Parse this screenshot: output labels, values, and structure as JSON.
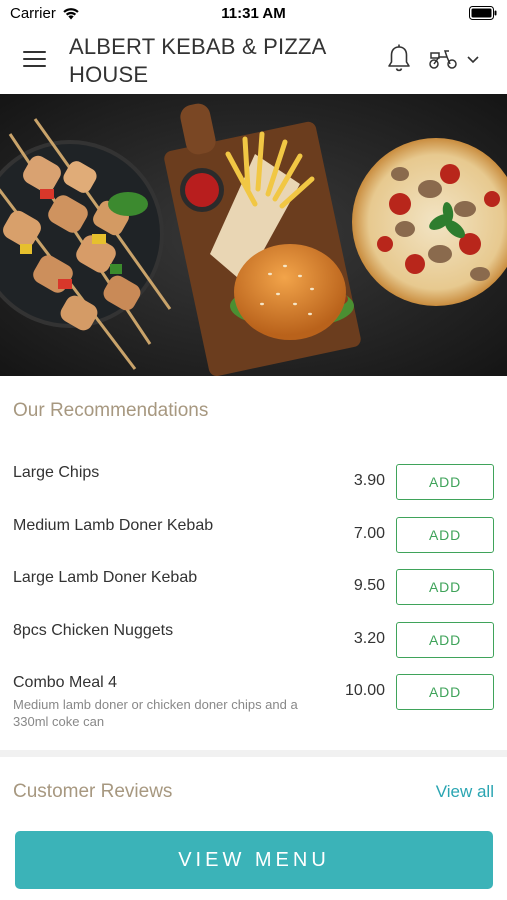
{
  "status_bar": {
    "carrier": "Carrier",
    "time": "11:31 AM"
  },
  "header": {
    "title": "ALBERT KEBAB & PIZZA HOUSE",
    "menu_icon": "hamburger-menu-icon",
    "bell_icon": "bell-icon",
    "delivery_icon": "scooter-icon",
    "dropdown_icon": "chevron-down-icon"
  },
  "hero": {
    "image": "food-banner-kebab-burger-pizza"
  },
  "recommendations": {
    "title": "Our Recommendations",
    "add_label": "ADD",
    "items": [
      {
        "name": "Large Chips",
        "price": "3.90",
        "description": ""
      },
      {
        "name": "Medium Lamb Doner Kebab",
        "price": "7.00",
        "description": ""
      },
      {
        "name": "Large Lamb Doner Kebab",
        "price": "9.50",
        "description": ""
      },
      {
        "name": "8pcs Chicken Nuggets",
        "price": "3.20",
        "description": ""
      },
      {
        "name": "Combo Meal 4",
        "price": "10.00",
        "description": "Medium lamb doner or chicken doner chips and a 330ml coke can"
      }
    ]
  },
  "reviews": {
    "title": "Customer Reviews",
    "view_all": "View all"
  },
  "cta": {
    "label": "VIEW MENU"
  },
  "colors": {
    "accent_teal": "#3bb3b8",
    "add_green": "#3fa35a",
    "section_title": "#a79880",
    "link_blue": "#2aa5b2"
  }
}
